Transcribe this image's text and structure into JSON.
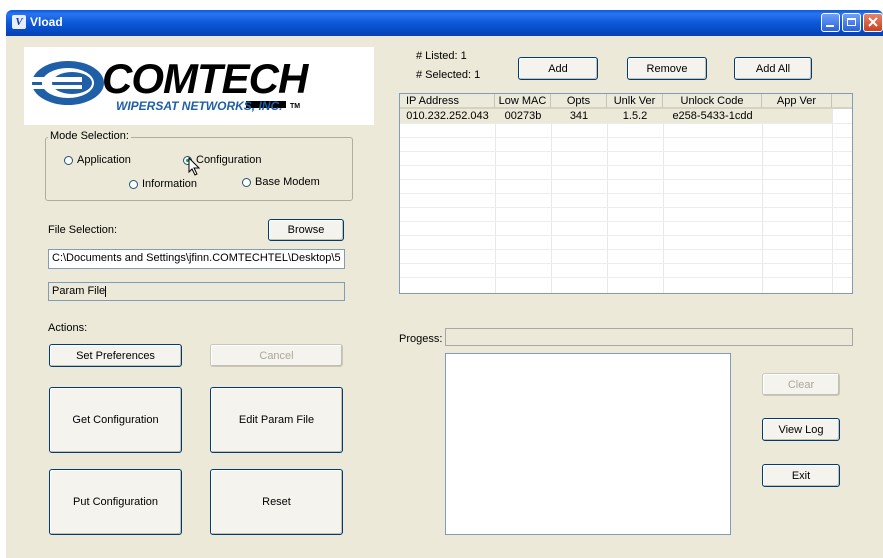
{
  "window": {
    "title": "Vload",
    "app_icon": "vload-app-icon"
  },
  "logo": {
    "brand": "COMTECH",
    "sub": "WIPERSAT NETWORKS, INC.",
    "tm": "TM"
  },
  "mode": {
    "group_label": "Mode Selection:",
    "options": [
      "Application",
      "Configuration",
      "Information",
      "Base Modem"
    ],
    "selected": "Configuration"
  },
  "file": {
    "label": "File Selection:",
    "browse_label": "Browse",
    "path": "C:\\Documents and Settings\\jfinn.COMTECHTEL\\Desktop\\5",
    "param_file": "Param File"
  },
  "actions": {
    "label": "Actions:",
    "set_preferences": "Set Preferences",
    "cancel": "Cancel",
    "get_configuration": "Get Configuration",
    "edit_param_file": "Edit Param File",
    "put_configuration": "Put Configuration",
    "reset": "Reset"
  },
  "list_info": {
    "listed": "# Listed: 1",
    "selected": "# Selected: 1"
  },
  "list_buttons": {
    "add": "Add",
    "remove": "Remove",
    "add_all": "Add All"
  },
  "table": {
    "columns": [
      "IP Address",
      "Low MAC",
      "Opts",
      "Unlk Ver",
      "Unlock Code",
      "App Ver"
    ],
    "rows": [
      [
        "010.232.252.043",
        "00273b",
        "341",
        "1.5.2",
        "e258-5433-1cdd",
        ""
      ]
    ]
  },
  "progress": {
    "label": "Progess:",
    "value": 0
  },
  "side_buttons": {
    "clear": "Clear",
    "view_log": "View Log",
    "exit": "Exit"
  },
  "colors": {
    "title_bar": "#0a58d8",
    "dialog_bg": "#ece9d8",
    "selected_row": "#ece9d8"
  }
}
